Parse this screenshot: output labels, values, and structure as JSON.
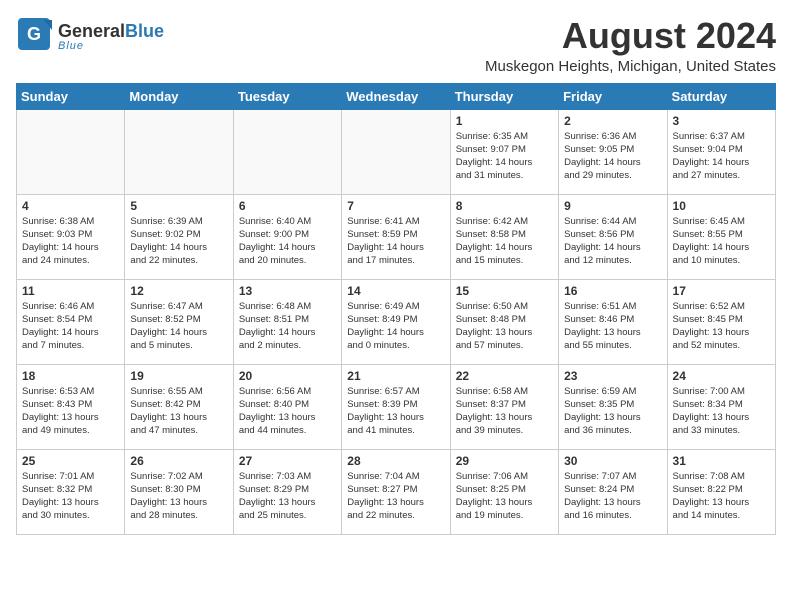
{
  "header": {
    "logo_general": "General",
    "logo_blue": "Blue",
    "month_title": "August 2024",
    "location": "Muskegon Heights, Michigan, United States"
  },
  "weekdays": [
    "Sunday",
    "Monday",
    "Tuesday",
    "Wednesday",
    "Thursday",
    "Friday",
    "Saturday"
  ],
  "weeks": [
    [
      {
        "day": "",
        "info": ""
      },
      {
        "day": "",
        "info": ""
      },
      {
        "day": "",
        "info": ""
      },
      {
        "day": "",
        "info": ""
      },
      {
        "day": "1",
        "info": "Sunrise: 6:35 AM\nSunset: 9:07 PM\nDaylight: 14 hours\nand 31 minutes."
      },
      {
        "day": "2",
        "info": "Sunrise: 6:36 AM\nSunset: 9:05 PM\nDaylight: 14 hours\nand 29 minutes."
      },
      {
        "day": "3",
        "info": "Sunrise: 6:37 AM\nSunset: 9:04 PM\nDaylight: 14 hours\nand 27 minutes."
      }
    ],
    [
      {
        "day": "4",
        "info": "Sunrise: 6:38 AM\nSunset: 9:03 PM\nDaylight: 14 hours\nand 24 minutes."
      },
      {
        "day": "5",
        "info": "Sunrise: 6:39 AM\nSunset: 9:02 PM\nDaylight: 14 hours\nand 22 minutes."
      },
      {
        "day": "6",
        "info": "Sunrise: 6:40 AM\nSunset: 9:00 PM\nDaylight: 14 hours\nand 20 minutes."
      },
      {
        "day": "7",
        "info": "Sunrise: 6:41 AM\nSunset: 8:59 PM\nDaylight: 14 hours\nand 17 minutes."
      },
      {
        "day": "8",
        "info": "Sunrise: 6:42 AM\nSunset: 8:58 PM\nDaylight: 14 hours\nand 15 minutes."
      },
      {
        "day": "9",
        "info": "Sunrise: 6:44 AM\nSunset: 8:56 PM\nDaylight: 14 hours\nand 12 minutes."
      },
      {
        "day": "10",
        "info": "Sunrise: 6:45 AM\nSunset: 8:55 PM\nDaylight: 14 hours\nand 10 minutes."
      }
    ],
    [
      {
        "day": "11",
        "info": "Sunrise: 6:46 AM\nSunset: 8:54 PM\nDaylight: 14 hours\nand 7 minutes."
      },
      {
        "day": "12",
        "info": "Sunrise: 6:47 AM\nSunset: 8:52 PM\nDaylight: 14 hours\nand 5 minutes."
      },
      {
        "day": "13",
        "info": "Sunrise: 6:48 AM\nSunset: 8:51 PM\nDaylight: 14 hours\nand 2 minutes."
      },
      {
        "day": "14",
        "info": "Sunrise: 6:49 AM\nSunset: 8:49 PM\nDaylight: 14 hours\nand 0 minutes."
      },
      {
        "day": "15",
        "info": "Sunrise: 6:50 AM\nSunset: 8:48 PM\nDaylight: 13 hours\nand 57 minutes."
      },
      {
        "day": "16",
        "info": "Sunrise: 6:51 AM\nSunset: 8:46 PM\nDaylight: 13 hours\nand 55 minutes."
      },
      {
        "day": "17",
        "info": "Sunrise: 6:52 AM\nSunset: 8:45 PM\nDaylight: 13 hours\nand 52 minutes."
      }
    ],
    [
      {
        "day": "18",
        "info": "Sunrise: 6:53 AM\nSunset: 8:43 PM\nDaylight: 13 hours\nand 49 minutes."
      },
      {
        "day": "19",
        "info": "Sunrise: 6:55 AM\nSunset: 8:42 PM\nDaylight: 13 hours\nand 47 minutes."
      },
      {
        "day": "20",
        "info": "Sunrise: 6:56 AM\nSunset: 8:40 PM\nDaylight: 13 hours\nand 44 minutes."
      },
      {
        "day": "21",
        "info": "Sunrise: 6:57 AM\nSunset: 8:39 PM\nDaylight: 13 hours\nand 41 minutes."
      },
      {
        "day": "22",
        "info": "Sunrise: 6:58 AM\nSunset: 8:37 PM\nDaylight: 13 hours\nand 39 minutes."
      },
      {
        "day": "23",
        "info": "Sunrise: 6:59 AM\nSunset: 8:35 PM\nDaylight: 13 hours\nand 36 minutes."
      },
      {
        "day": "24",
        "info": "Sunrise: 7:00 AM\nSunset: 8:34 PM\nDaylight: 13 hours\nand 33 minutes."
      }
    ],
    [
      {
        "day": "25",
        "info": "Sunrise: 7:01 AM\nSunset: 8:32 PM\nDaylight: 13 hours\nand 30 minutes."
      },
      {
        "day": "26",
        "info": "Sunrise: 7:02 AM\nSunset: 8:30 PM\nDaylight: 13 hours\nand 28 minutes."
      },
      {
        "day": "27",
        "info": "Sunrise: 7:03 AM\nSunset: 8:29 PM\nDaylight: 13 hours\nand 25 minutes."
      },
      {
        "day": "28",
        "info": "Sunrise: 7:04 AM\nSunset: 8:27 PM\nDaylight: 13 hours\nand 22 minutes."
      },
      {
        "day": "29",
        "info": "Sunrise: 7:06 AM\nSunset: 8:25 PM\nDaylight: 13 hours\nand 19 minutes."
      },
      {
        "day": "30",
        "info": "Sunrise: 7:07 AM\nSunset: 8:24 PM\nDaylight: 13 hours\nand 16 minutes."
      },
      {
        "day": "31",
        "info": "Sunrise: 7:08 AM\nSunset: 8:22 PM\nDaylight: 13 hours\nand 14 minutes."
      }
    ]
  ]
}
